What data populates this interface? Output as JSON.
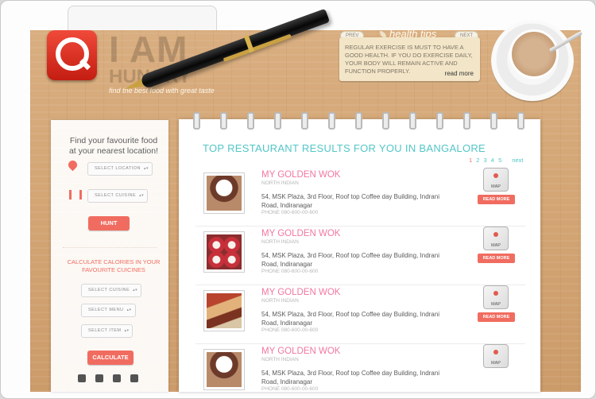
{
  "brand": {
    "title_line1": "I AM",
    "title_line2": "HUNGRY",
    "tagline": "find the best food with great taste"
  },
  "health_tips": {
    "title": "health tips",
    "prev_label": "PREV",
    "next_label": "NEXT",
    "text": "REGULAR EXERCISE IS MUST TO HAVE A GOOD HEALTH. IF YOU DO EXERCISE DAILY, YOUR BODY WILL REMAIN ACTIVE AND FUNCTION PROPERLY.",
    "read_more": "read more"
  },
  "sidebar": {
    "heading": "Find your favourite food at your nearest location!",
    "select_location": "SELECT LOCATION",
    "select_cuisine": "SELECT CUISINE",
    "hunt_label": "HUNT",
    "calories_heading": "CALCULATE CALORIES IN YOUR FAVOURITE CUICINES",
    "calc_cuisine": "SELECT CUISINE",
    "calc_menu": "SELECT MENU",
    "calc_item": "SELECT ITEM",
    "calculate_label": "CALCULATE",
    "food_icons": [
      "drink-icon",
      "fastfood-icon",
      "ice-cream-icon",
      "cone-icon"
    ]
  },
  "results": {
    "title": "TOP RESTAURANT RESULTS FOR YOU IN BANGALORE",
    "pages": [
      "1",
      "2",
      "3",
      "4",
      "5"
    ],
    "active_page": "1",
    "next_label": "next",
    "map_label": "MAP",
    "read_more_label": "READ MORE",
    "items": [
      {
        "name": "MY GOLDEN WOK",
        "cuisine": "NORTH INDIAN",
        "address": "54, MSK Plaza, 3rd Floor, Roof top Coffee day Building, Indrani Road, Indiranagar",
        "phone": "PHONE  080-600-00-600"
      },
      {
        "name": "MY GOLDEN WOK",
        "cuisine": "NORTH INDIAN",
        "address": "54, MSK Plaza, 3rd Floor, Roof top Coffee day Building, Indrani Road, Indiranagar",
        "phone": "PHONE  080-600-00-600"
      },
      {
        "name": "MY GOLDEN WOK",
        "cuisine": "NORTH INDIAN",
        "address": "54, MSK Plaza, 3rd Floor, Roof top Coffee day Building, Indrani Road, Indiranagar",
        "phone": "PHONE  080-600-00-600"
      },
      {
        "name": "MY GOLDEN WOK",
        "cuisine": "NORTH INDIAN",
        "address": "54, MSK Plaza, 3rd Floor, Roof top Coffee day Building, Indrani Road, Indiranagar",
        "phone": "PHONE  080-600-00-600"
      }
    ]
  },
  "colors": {
    "accent_red": "#f16c60",
    "teal": "#53c6c7",
    "pink": "#f2789f",
    "wood": "#d3a574"
  }
}
